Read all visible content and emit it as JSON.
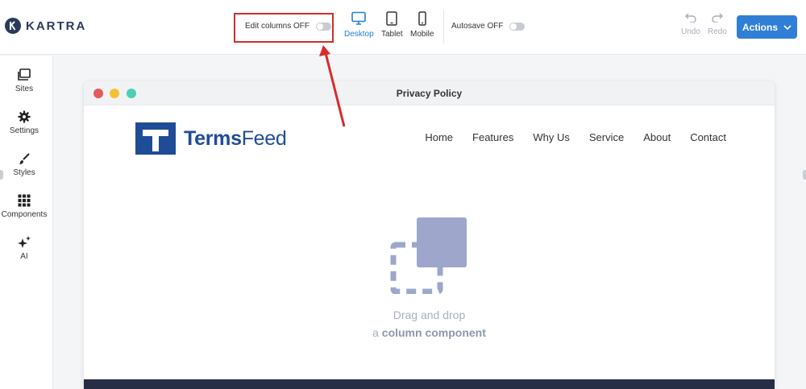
{
  "app": {
    "logo_text": "KARTRA"
  },
  "toolbar": {
    "edit_columns_label": "Edit columns OFF",
    "devices": [
      {
        "label": "Desktop",
        "active": true
      },
      {
        "label": "Tablet",
        "active": false
      },
      {
        "label": "Mobile",
        "active": false
      }
    ],
    "autosave_label": "Autosave OFF",
    "undo_label": "Undo",
    "redo_label": "Redo",
    "actions_label": "Actions"
  },
  "sidebar": {
    "items": [
      {
        "label": "Sites",
        "icon": "sites-icon"
      },
      {
        "label": "Settings",
        "icon": "gear-icon"
      },
      {
        "label": "Styles",
        "icon": "brush-icon"
      },
      {
        "label": "Components",
        "icon": "grid-icon"
      },
      {
        "label": "AI",
        "icon": "sparkle-icon"
      }
    ]
  },
  "canvas": {
    "window_title": "Privacy Policy",
    "brand": {
      "bold": "Terms",
      "light": "Feed"
    },
    "nav": [
      "Home",
      "Features",
      "Why Us",
      "Service",
      "About",
      "Contact"
    ],
    "dropzone": {
      "line1": "Drag and drop",
      "line2_prefix": "a",
      "line2_bold": "column component"
    }
  },
  "colors": {
    "accent": "#2f7fd6",
    "brand": "#1f4c96",
    "highlight": "#d62c2c",
    "footer": "#262d44"
  }
}
